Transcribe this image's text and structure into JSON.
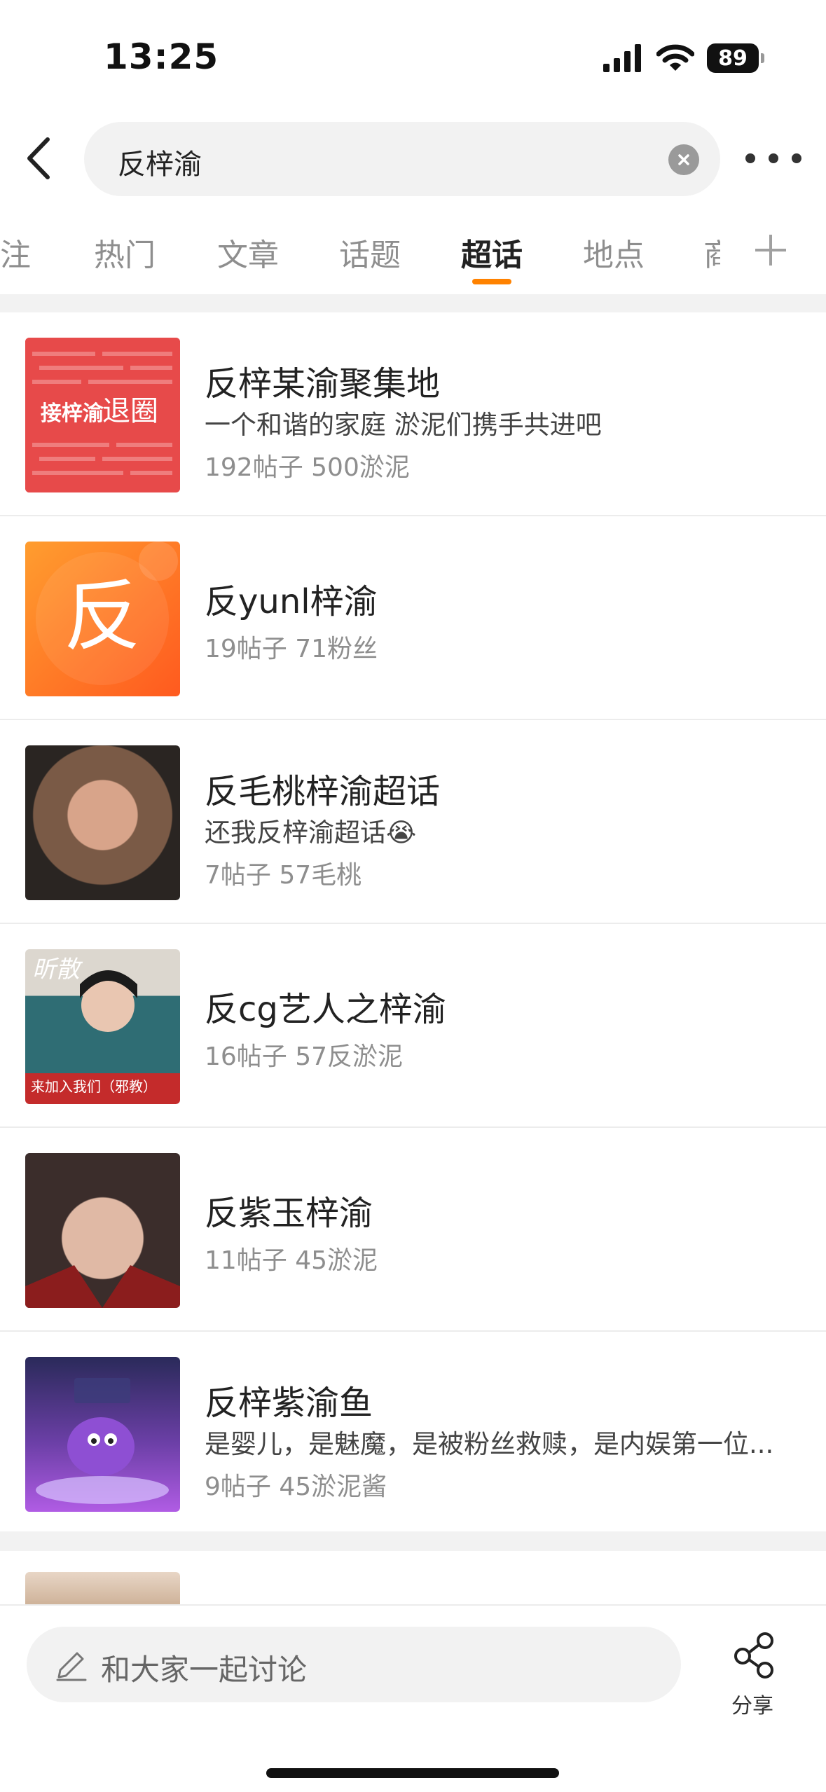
{
  "status_bar": {
    "time": "13:25",
    "battery": "89"
  },
  "search": {
    "query": "反梓渝"
  },
  "tabs": [
    {
      "label": "关注"
    },
    {
      "label": "热门"
    },
    {
      "label": "文章"
    },
    {
      "label": "话题"
    },
    {
      "label": "超话"
    },
    {
      "label": "地点"
    },
    {
      "label": "商"
    }
  ],
  "active_tab": "超话",
  "results": [
    {
      "title": "反梓某渝聚集地",
      "desc": "一个和谐的家庭 淤泥们携手共进吧",
      "meta": "192帖子 500淤泥",
      "thumb_text_1": "接梓渝",
      "thumb_text_2": "退圈"
    },
    {
      "title": "反yunl梓渝",
      "desc": "",
      "meta": "19帖子 71粉丝",
      "thumb_text_1": "反"
    },
    {
      "title": "反毛桃梓渝超话",
      "desc": "还我反梓渝超话😭",
      "meta": "7帖子 57毛桃"
    },
    {
      "title": "反cg艺人之梓渝",
      "desc": "",
      "meta": "16帖子 57反淤泥",
      "thumb_text_1": "昕散",
      "thumb_text_2": "来加入我们（邪教）"
    },
    {
      "title": "反紫玉梓渝",
      "desc": "",
      "meta": "11帖子 45淤泥"
    },
    {
      "title": "反梓紫渝鱼",
      "desc": "是婴儿，是魅魔，是被粉丝救赎，是内娱第一位...",
      "meta": "9帖子 45淤泥酱"
    }
  ],
  "bottom": {
    "discuss_placeholder": "和大家一起讨论",
    "share_label": "分享"
  },
  "colors": {
    "accent": "#ff8200",
    "tab_active": "#222222",
    "tab_inactive": "#8e8e8e"
  }
}
